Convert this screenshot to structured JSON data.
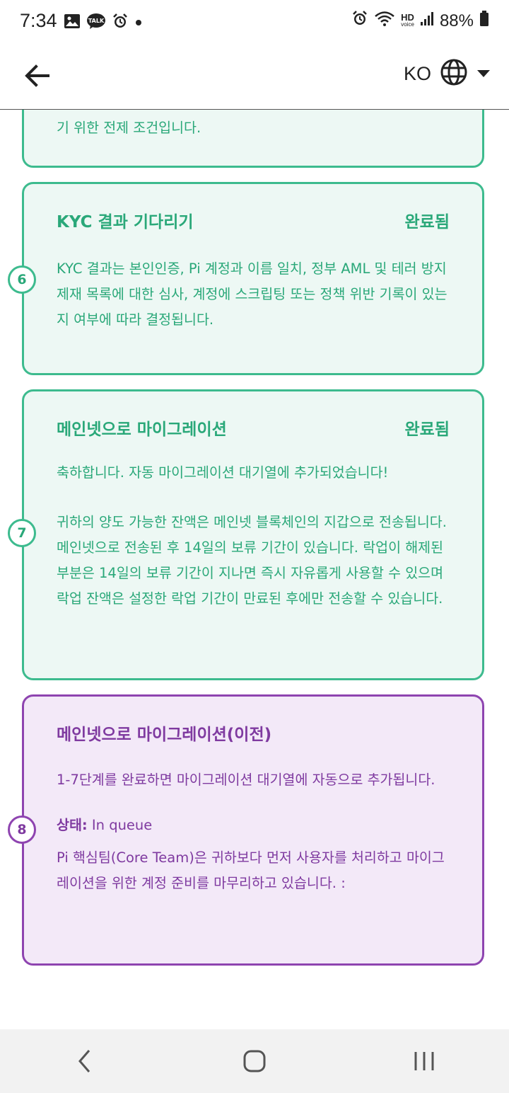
{
  "status_bar": {
    "time": "7:34",
    "battery": "88%",
    "left_icons": [
      "gallery-icon",
      "talk-icon",
      "alarm-icon",
      "dot-icon"
    ],
    "right_icons": [
      "alarm-icon",
      "wifi-icon",
      "hd-voice-icon",
      "signal-icon",
      "battery-icon"
    ],
    "hd_top": "HD",
    "hd_bottom": "voice"
  },
  "app_bar": {
    "back_icon": "arrow-left-icon",
    "language_code": "KO",
    "globe_icon": "globe-icon",
    "dropdown_icon": "caret-down-icon"
  },
  "partial_card": {
    "text": "기 위한 전제 조건입니다."
  },
  "cards": [
    {
      "step": "6",
      "title": "KYC 결과 기다리기",
      "status": "완료됨",
      "body": "KYC 결과는 본인인증, Pi 계정과 이름 일치, 정부 AML 및 테러 방지 제재 목록에 대한 심사, 계정에 스크립팅 또는 정책 위반 기록이 있는지 여부에 따라 결정됩니다."
    },
    {
      "step": "7",
      "title": "메인넷으로 마이그레이션",
      "status": "완료됨",
      "body1": "축하합니다. 자동 마이그레이션 대기열에 추가되었습니다!",
      "body2": "귀하의 양도 가능한 잔액은 메인넷 블록체인의 지갑으로 전송됩니다. 메인넷으로 전송된 후 14일의 보류 기간이 있습니다. 락업이 해제된 부분은 14일의 보류 기간이 지나면 즉시 자유롭게 사용할 수 있으며 락업 잔액은 설정한 락업 기간이 만료된 후에만 전송할 수 있습니다."
    },
    {
      "step": "8",
      "title": "메인넷으로 마이그레이션(이전)",
      "body1": "1-7단계를 완료하면 마이그레이션 대기열에 자동으로 추가됩니다.",
      "status_label": "상태:",
      "status_value": "In queue",
      "body2": "Pi 핵심팀(Core Team)은 귀하보다 먼저 사용자를 처리하고 마이그레이션을 위한 계정 준비를 마무리하고 있습니다. :"
    }
  ],
  "nav_bar": {
    "back": "nav-back-icon",
    "home": "nav-home-icon",
    "recents": "nav-recents-icon"
  },
  "colors": {
    "green_border": "#3dbb8e",
    "green_text": "#2aa879",
    "green_bg": "#edf8f4",
    "purple_border": "#8e44b0",
    "purple_text": "#7f3aa0",
    "purple_bg": "#f3e9f8"
  }
}
